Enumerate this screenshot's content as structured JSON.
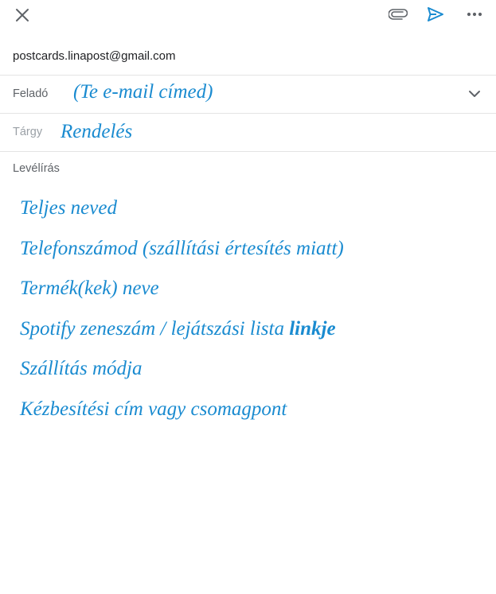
{
  "toolbar": {
    "close_icon": "close-icon",
    "attach_icon": "paperclip-icon",
    "send_icon": "send-icon",
    "more_icon": "more-horizontal-icon",
    "accent_color": "#1a8bd0"
  },
  "compose": {
    "to_value": "postcards.linapost@gmail.com",
    "from_label": "Feladó",
    "from_value": "(Te e-mail címed)",
    "subject_label": "Tárgy",
    "subject_value": "Rendelés",
    "body_label": "Levélírás",
    "body_lines": [
      "Teljes neved",
      "Telefonszámod (szállítási értesítés miatt)",
      "Termék(kek) neve",
      "Spotify zeneszám / lejátszási lista ",
      "Szállítás módja",
      "Kézbesítési cím vagy csomagpont"
    ],
    "body_line_4_bold": "linkje"
  }
}
